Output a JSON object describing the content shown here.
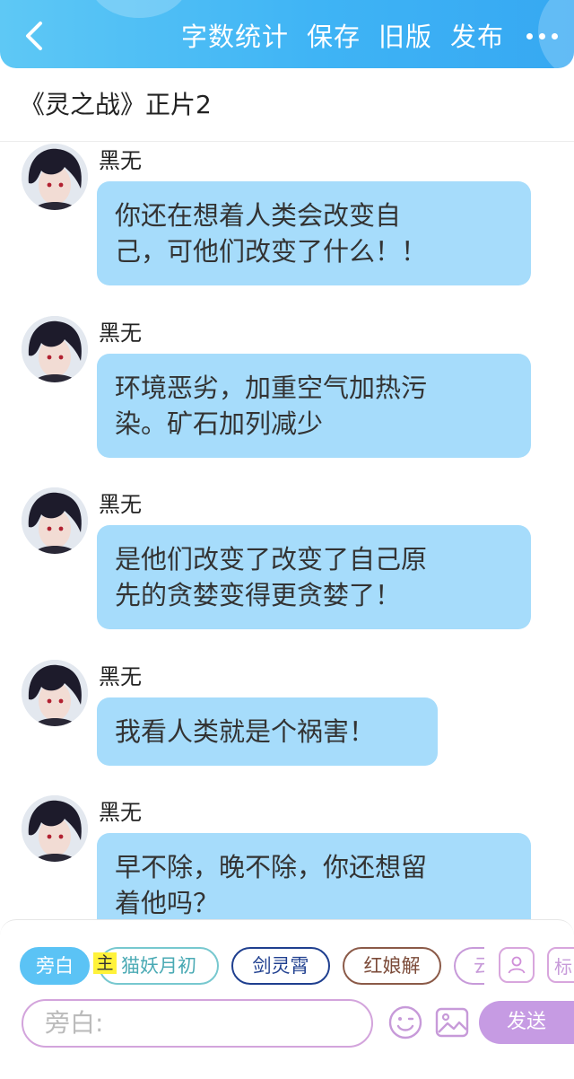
{
  "header": {
    "actions": [
      "字数统计",
      "保存",
      "旧版",
      "发布"
    ]
  },
  "chapter": {
    "title": "《灵之战》正片2"
  },
  "messages": [
    {
      "sender": "黑无",
      "lines": [
        "你还在想着人类会改变自",
        "己，可他们改变了什么！！"
      ]
    },
    {
      "sender": "黑无",
      "lines": [
        "环境恶劣，加重空气加热污",
        "染。矿石加列减少"
      ]
    },
    {
      "sender": "黑无",
      "lines": [
        "是他们改变了改变了自己原",
        "先的贪婪变得更贪婪了！"
      ]
    },
    {
      "sender": "黑无",
      "lines": [
        "我看人类就是个祸害！"
      ]
    },
    {
      "sender": "黑无",
      "lines": [
        "早不除，晚不除，你还想留",
        "着他吗？"
      ]
    }
  ],
  "characters": {
    "narrator": "旁白",
    "main_badge": "主",
    "cat": "猫妖月初",
    "sword": "剑灵霄",
    "red": "红娘解",
    "cloud_partial": "云",
    "tag_partial": "标"
  },
  "composer": {
    "placeholder": "旁白:",
    "send_label": "发送"
  },
  "colors": {
    "header_gradient": [
      "#5ec8f5",
      "#36a8f2"
    ],
    "bubble": "#a6dcfb",
    "send": "#c69be3",
    "narrator_chip": "#5bc3f5"
  },
  "icons": [
    "back-arrow-icon",
    "more-dots-icon",
    "person-icon",
    "emoji-icon",
    "image-icon"
  ]
}
